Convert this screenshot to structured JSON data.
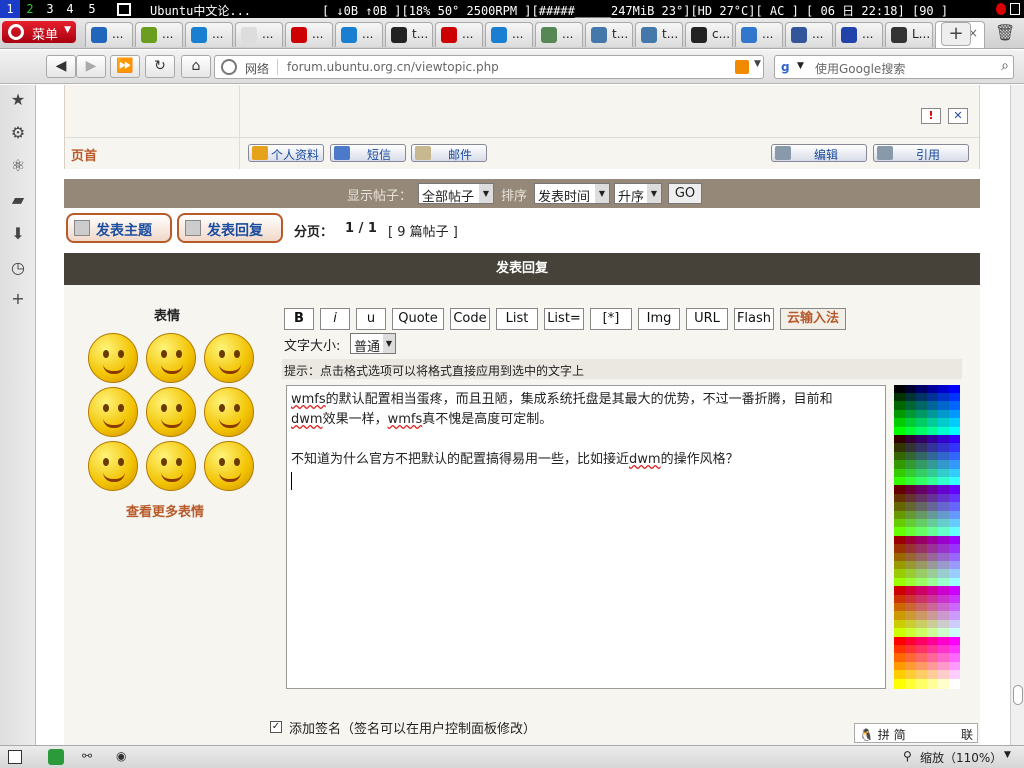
{
  "topbar": {
    "workspaces": [
      "1",
      "2",
      "3",
      "4",
      "5"
    ],
    "window_title": "Ubuntu中文论...",
    "stats": "[ ↓0B ↑0B ][18% 50° 2500RPM ][#####_____247MiB  23°][HD 27°C][ AC ] [ 06 日 22:18] [90 ]"
  },
  "browser": {
    "menu_label": "菜单",
    "tabs": [
      {
        "label": "...",
        "color": "#2266bb"
      },
      {
        "label": "...",
        "color": "#6b9e1f"
      },
      {
        "label": "...",
        "color": "#1a7fd0"
      },
      {
        "label": "...",
        "color": "#dddddd"
      },
      {
        "label": "...",
        "color": "#cc0000"
      },
      {
        "label": "...",
        "color": "#1a7fd0"
      },
      {
        "label": "t...",
        "color": "#222222"
      },
      {
        "label": "...",
        "color": "#cc0000"
      },
      {
        "label": "...",
        "color": "#1a7fd0"
      },
      {
        "label": "...",
        "color": "#558855"
      },
      {
        "label": "t...",
        "color": "#4477aa"
      },
      {
        "label": "t...",
        "color": "#4477aa"
      },
      {
        "label": "c...",
        "color": "#222222"
      },
      {
        "label": "...",
        "color": "#3377cc"
      },
      {
        "label": "...",
        "color": "#335599"
      },
      {
        "label": "...",
        "color": "#2244aa"
      },
      {
        "label": "L...",
        "color": "#333333"
      },
      {
        "label": "",
        "color": "#e05a00",
        "active": true
      }
    ],
    "close_glyph": "×",
    "add_tab_glyph": "+",
    "address_label": "网络",
    "url": "forum.ubuntu.org.cn/viewtopic.php",
    "search_placeholder": "使用Google搜索",
    "search_logo": "g"
  },
  "post": {
    "location_label": "页首",
    "buttons": {
      "profile": "个人资料",
      "pm": "短信",
      "email": "邮件",
      "edit": "编辑",
      "quote": "引用"
    }
  },
  "filter": {
    "show_label": "显示帖子：",
    "show_value": "全部帖子",
    "sort_label": "排序",
    "sort_value": "发表时间",
    "order_value": "升序",
    "go_label": "GO"
  },
  "actions": {
    "new_topic": "发表主题",
    "reply": "发表回复",
    "pagination_label": "分页：",
    "pagination_value": "1 / 1",
    "post_count": "[ 9 篇帖子 ]"
  },
  "reply": {
    "header": "发表回复",
    "smilies_title": "表情",
    "more_smilies": "查看更多表情",
    "format_buttons": [
      "B",
      "i",
      "u",
      "Quote",
      "Code",
      "List",
      "List=",
      "[*]",
      "Img",
      "URL",
      "Flash",
      "云输入法"
    ],
    "font_size_label": "文字大小:",
    "font_size_value": "普通",
    "hint": "提示：点击格式选项可以将格式直接应用到选中的文字上",
    "message_line1_a": "wmfs",
    "message_line1_b": "的默认配置相当蛋疼，而且丑陋，集成系统托盘是其最大的优势，不过一番折腾，目前和",
    "message_line2_a": "dwm",
    "message_line2_b": "效果一样，",
    "message_line2_c": "wmfs",
    "message_line2_d": "真不愧是高度可定制。",
    "message_line3_a": "不知道为什么官方不把默认的配置搞得易用一些，比如接近",
    "message_line3_b": "dwm",
    "message_line3_c": "的操作风格？",
    "signature_label": "添加签名（签名可以在用户控制面板修改）"
  },
  "status": {
    "ime": "拼 简",
    "ime_extra": "联",
    "zoom": "缩放（110%）"
  }
}
